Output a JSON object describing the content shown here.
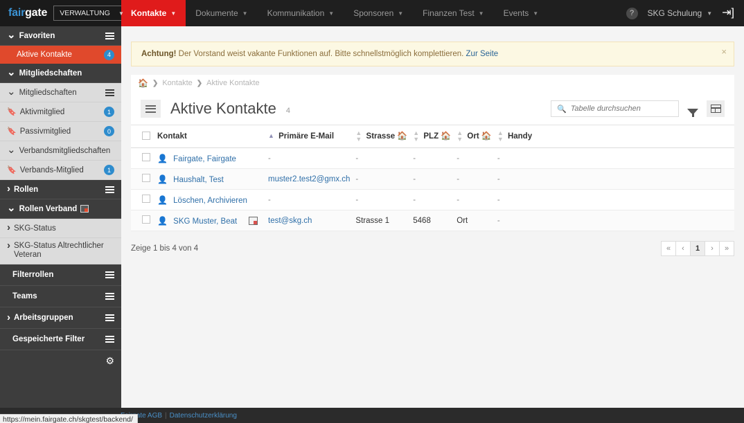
{
  "topbar": {
    "logo_fair": "fair",
    "logo_gate": "gate",
    "org_selector": "VERWALTUNG",
    "nav": [
      {
        "label": "Kontakte",
        "active": true
      },
      {
        "label": "Dokumente",
        "active": false
      },
      {
        "label": "Kommunikation",
        "active": false
      },
      {
        "label": "Sponsoren",
        "active": false
      },
      {
        "label": "Finanzen Test",
        "active": false
      },
      {
        "label": "Events",
        "active": false
      }
    ],
    "help_icon": "question-mark-icon",
    "user": "SKG Schulung",
    "logout_icon": "logout-icon",
    "active_color": "#e01b1b"
  },
  "sidebar": {
    "sections": [
      {
        "label": "Favoriten",
        "type": "dark",
        "toggle": "down",
        "menu": true
      },
      {
        "label": "Aktive Kontakte",
        "type": "active",
        "badge": "4"
      },
      {
        "label": "Mitgliedschaften",
        "type": "dark",
        "toggle": "down",
        "menu": false
      },
      {
        "label": "Mitgliedschaften",
        "type": "light",
        "toggle": "down",
        "menu": true
      },
      {
        "label": "Aktivmitglied",
        "type": "light",
        "icon": "bookmark-icon",
        "badge": "1"
      },
      {
        "label": "Passivmitglied",
        "type": "light",
        "icon": "bookmark-icon",
        "badge": "0"
      },
      {
        "label": "Verbandsmitgliedschaften",
        "type": "light",
        "toggle": "down"
      },
      {
        "label": "Verbands-Mitglied",
        "type": "light",
        "icon": "bookmark-icon",
        "badge": "1"
      },
      {
        "label": "Rollen",
        "type": "dark",
        "toggle": "right",
        "menu": true
      },
      {
        "label": "Rollen Verband",
        "type": "dark",
        "toggle": "down",
        "calendar": true
      },
      {
        "label": "SKG-Status",
        "type": "light",
        "toggle": "right"
      },
      {
        "label": "SKG-Status Altrechtlicher Veteran",
        "type": "light",
        "toggle": "right",
        "tall": true
      },
      {
        "label": "Filterrollen",
        "type": "dark",
        "menu": true
      },
      {
        "label": "Teams",
        "type": "dark",
        "menu": true
      },
      {
        "label": "Arbeitsgruppen",
        "type": "dark",
        "toggle": "right",
        "menu": true
      },
      {
        "label": "Gespeicherte Filter",
        "type": "dark",
        "menu": true
      }
    ],
    "settings_icon": "gear-icon",
    "badge_color": "#2e8ccd",
    "active_color": "#e0492c"
  },
  "alert": {
    "strong": "Achtung!",
    "text": "Der Vorstand weist vakante Funktionen auf. Bitte schnellstmöglich komplettieren.",
    "link": "Zur Seite",
    "close_icon": "close-icon"
  },
  "breadcrumb": {
    "home_icon": "home-icon",
    "items": [
      "Kontakte",
      "Aktive Kontakte"
    ]
  },
  "page": {
    "menu_icon": "hamburger-icon",
    "title": "Aktive Kontakte",
    "count": "4"
  },
  "search": {
    "icon": "search-icon",
    "placeholder": "Tabelle durchsuchen",
    "value": ""
  },
  "toolbar": {
    "filter_icon": "funnel-icon",
    "columns_icon": "table-grid-icon"
  },
  "table": {
    "select_all_icon": "checkbox-icon",
    "columns": [
      {
        "label": "Kontakt",
        "sort": "asc",
        "house": false
      },
      {
        "label": "Primäre E-Mail",
        "sort": "none",
        "house": false
      },
      {
        "label": "Strasse",
        "sort": "none",
        "house": true
      },
      {
        "label": "PLZ",
        "sort": "none",
        "house": true
      },
      {
        "label": "Ort",
        "sort": "none",
        "house": true
      },
      {
        "label": "Handy",
        "sort": "none",
        "house": false
      }
    ],
    "rows": [
      {
        "person_icon": "person-icon-green",
        "name": "Fairgate, Fairgate",
        "row_icon": false,
        "email": "-",
        "email_link": false,
        "strasse": "-",
        "plz": "-",
        "ort": "-",
        "handy": "-"
      },
      {
        "person_icon": "person-icon",
        "name": "Haushalt, Test",
        "row_icon": false,
        "email": "muster2.test2@gmx.ch",
        "email_link": true,
        "strasse": "-",
        "plz": "-",
        "ort": "-",
        "handy": "-"
      },
      {
        "person_icon": "person-icon",
        "name": "Löschen, Archivieren",
        "row_icon": false,
        "email": "-",
        "email_link": false,
        "strasse": "-",
        "plz": "-",
        "ort": "-",
        "handy": "-"
      },
      {
        "person_icon": "person-icon",
        "name": "SKG Muster, Beat",
        "row_icon": true,
        "email": "test@skg.ch",
        "email_link": true,
        "strasse": "Strasse 1",
        "plz": "5468",
        "ort": "Ort",
        "handy": "-"
      }
    ],
    "summary": "Zeige 1 bis 4 von 4",
    "pager": [
      "«",
      "‹",
      "1",
      "›",
      "»"
    ],
    "pager_current": "1"
  },
  "footer": {
    "agb": "Fairgate AGB",
    "separator": "|",
    "privacy": "Datenschutzerklärung",
    "status_url": "https://mein.fairgate.ch/skgtest/backend/"
  }
}
